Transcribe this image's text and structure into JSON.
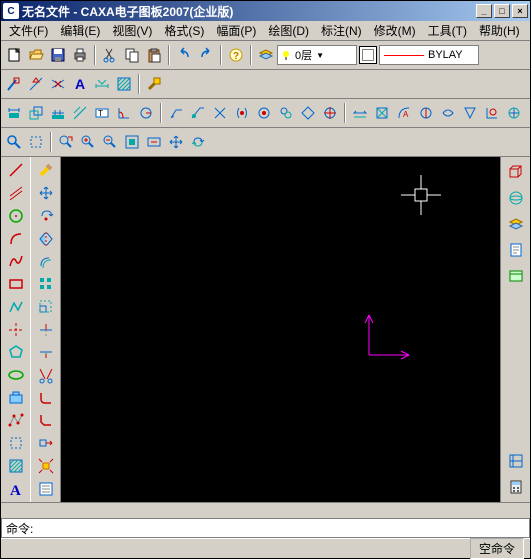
{
  "window": {
    "app_icon": "C",
    "title": "无名文件 - CAXA电子图板2007(企业版)",
    "minimize": "_",
    "maximize": "□",
    "close": "×"
  },
  "menu": {
    "file": "文件(F)",
    "edit": "编辑(E)",
    "view": "视图(V)",
    "format": "格式(S)",
    "paper": "幅面(P)",
    "draw": "绘图(D)",
    "dimension": "标注(N)",
    "modify": "修改(M)",
    "tools": "工具(T)",
    "help": "帮助(H)"
  },
  "layer": {
    "current": "0层",
    "linetype": "BYLAY"
  },
  "command": {
    "prompt": "命令:"
  },
  "status": {
    "mode": "空命令"
  },
  "icons": {
    "new": "new",
    "open": "open",
    "save": "save",
    "print": "print",
    "cut": "cut",
    "copy": "copy",
    "paste": "paste",
    "undo": "undo",
    "redo": "redo",
    "help": "help",
    "layers": "layers",
    "linecolor": "linecolor"
  }
}
